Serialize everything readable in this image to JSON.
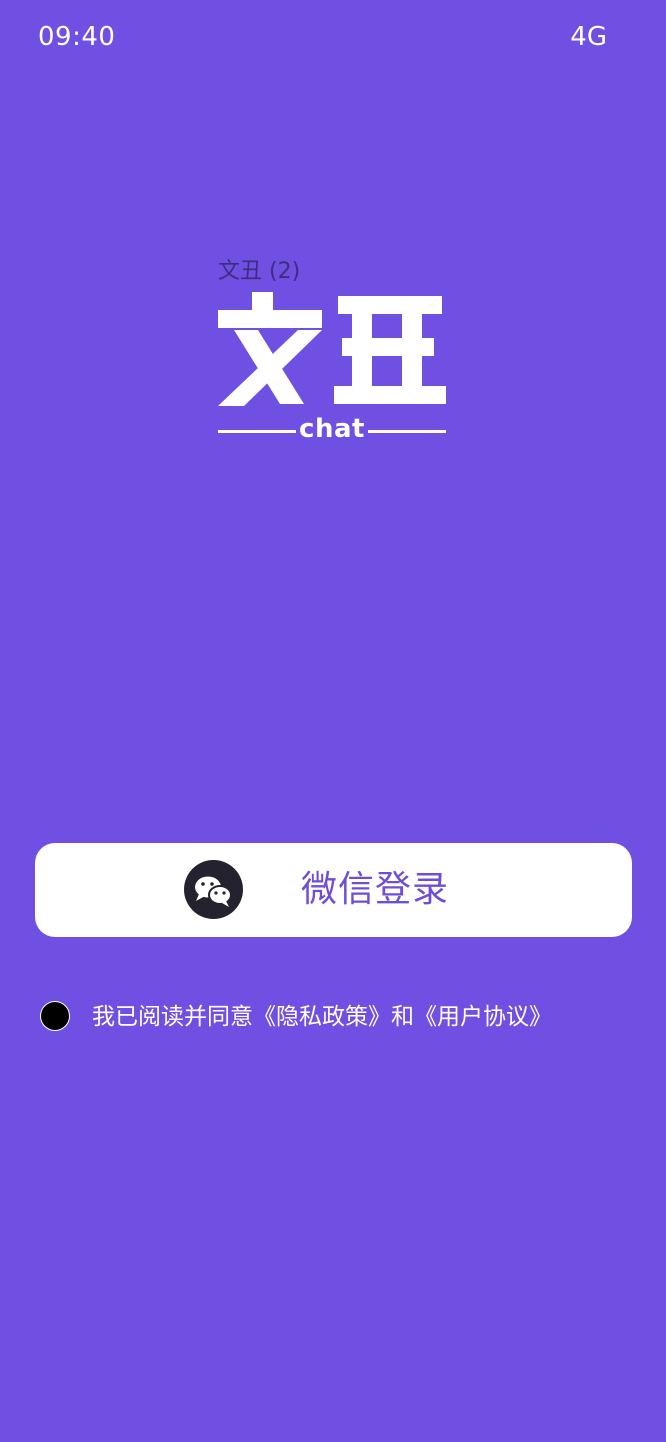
{
  "status_bar": {
    "time": "09:40",
    "network": "4G"
  },
  "logo": {
    "caption": "文丑 (2)",
    "title": "文丑",
    "subtitle": "chat"
  },
  "login": {
    "icon": "wechat-icon",
    "label": "微信登录"
  },
  "agreement": {
    "checked": false,
    "text": "我已阅读并同意《隐私政策》和《用户协议》"
  },
  "colors": {
    "background": "#7050E2",
    "button_background": "#FFFFFF",
    "button_text": "#6F4DD8",
    "wechat_badge": "#23222E",
    "logo_caption": "#3C2D7E"
  }
}
